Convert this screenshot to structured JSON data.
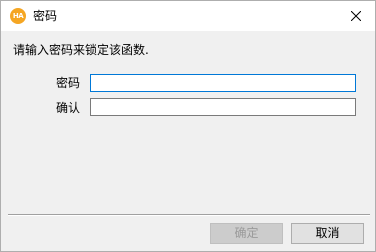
{
  "window": {
    "title": "密码",
    "app_icon_text": "HA",
    "close_glyph": "close-icon"
  },
  "dialog": {
    "description": "请输入密码来锁定该函数."
  },
  "form": {
    "password_label": "密码",
    "password_value": "",
    "confirm_label": "确认",
    "confirm_value": ""
  },
  "buttons": {
    "ok_label": "确定",
    "ok_enabled": false,
    "cancel_label": "取消"
  },
  "colors": {
    "accent": "#0078d7",
    "icon_orange": "#f5a623"
  }
}
